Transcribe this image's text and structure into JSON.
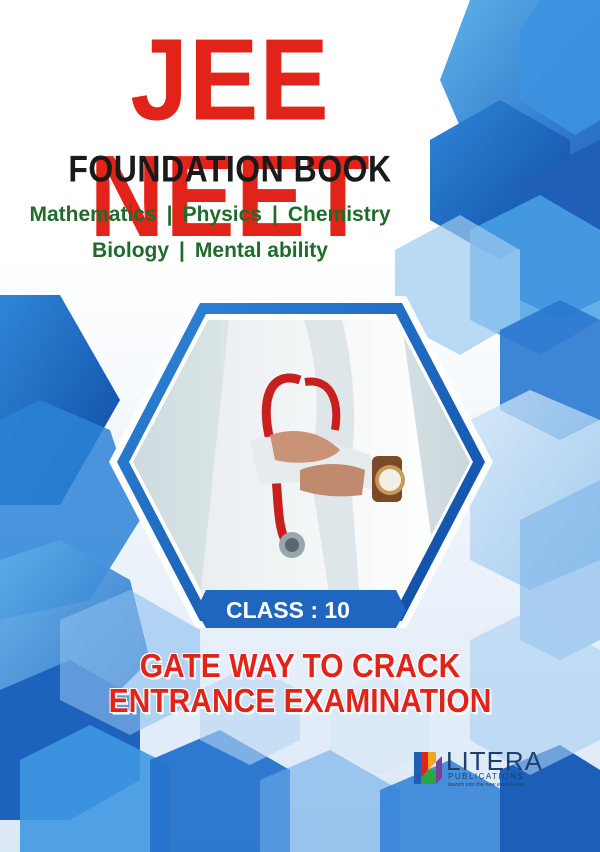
{
  "title": {
    "main": "JEE NEET",
    "sub": "FOUNDATION BOOK"
  },
  "subjects": {
    "row1": [
      "Mathematics",
      "Physics",
      "Chemistry"
    ],
    "row2": [
      "Biology",
      "Mental ability"
    ],
    "separator": "|"
  },
  "class_label": "CLASS : 10",
  "tagline": {
    "line1": "GATE WAY TO CRACK",
    "line2": "ENTRANCE EXAMINATION"
  },
  "publisher": {
    "name": "LITERA",
    "sub": "PUBLICATIONS",
    "tagline": "launch into the new experience..."
  },
  "colors": {
    "title_red": "#e2231a",
    "subject_green": "#1e6b2a",
    "hex_blue": "#2b7fd0",
    "logo_navy": "#1d3f6e"
  },
  "image": {
    "subject": "doctor-with-stethoscope-photo"
  }
}
